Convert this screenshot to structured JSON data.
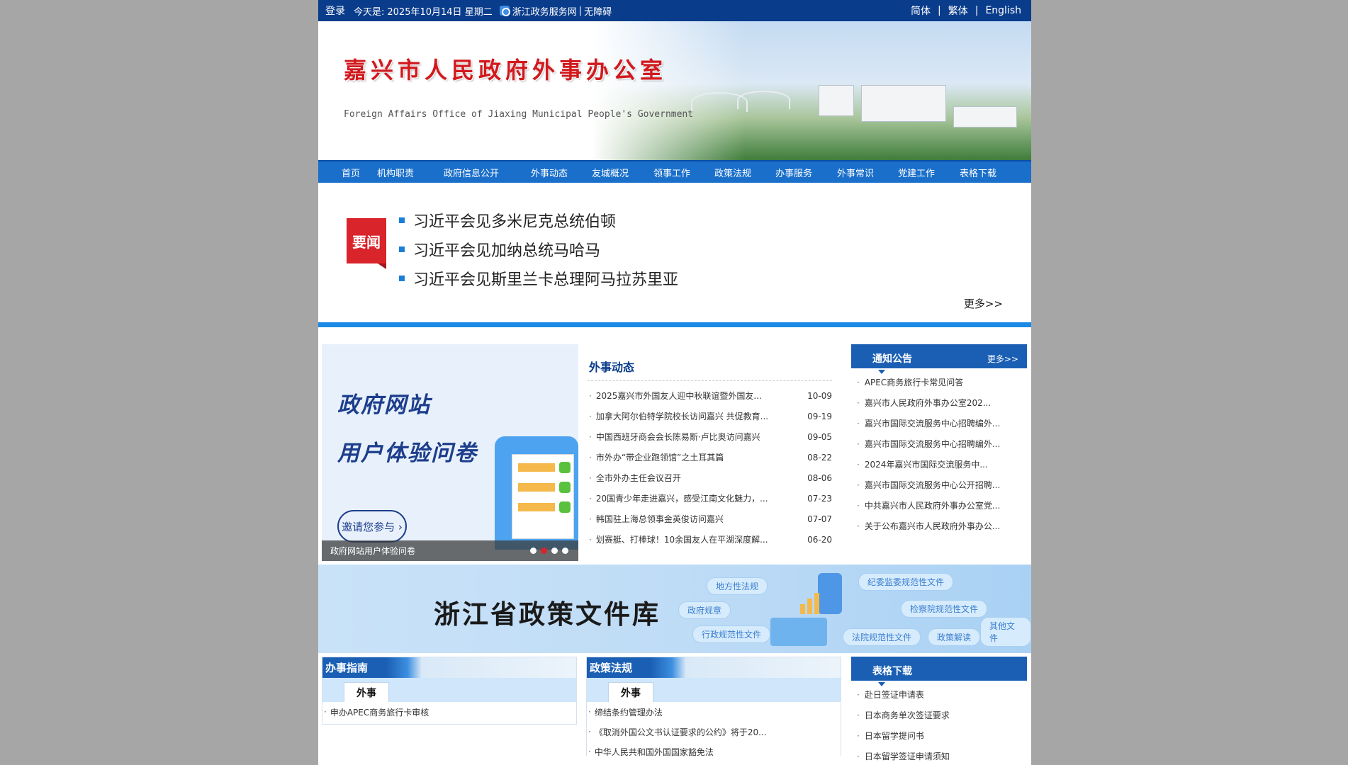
{
  "topbar": {
    "login": "登录",
    "today_label": "今天是:",
    "date": "2025年10月14日 星期二",
    "zw_link": "浙江政务服务网",
    "sep": "|",
    "accessibility": "无障碍",
    "lang_simple": "简体",
    "lang_trad": "繁体",
    "lang_en": "English"
  },
  "banner": {
    "title": "嘉兴市人民政府外事办公室",
    "subtitle": "Foreign Affairs Office of Jiaxing Municipal People's Government"
  },
  "nav": [
    "首页",
    "机构职责",
    "政府信息公开",
    "外事动态",
    "友城概况",
    "领事工作",
    "政策法规",
    "办事服务",
    "外事常识",
    "党建工作",
    "表格下载"
  ],
  "headline": {
    "badge": "要闻",
    "items": [
      "习近平会见多米尼克总统伯顿",
      "习近平会见加纳总统马哈马",
      "习近平会见斯里兰卡总理阿马拉苏里亚"
    ],
    "more": "更多>>"
  },
  "slider": {
    "line1": "政府网站",
    "line2": "用户体验问卷",
    "invite": "邀请您参与 ›",
    "caption": "政府网站用户体验问卷",
    "dots": 4,
    "active_dot": 2
  },
  "news": {
    "title": "外事动态",
    "items": [
      {
        "text": "2025嘉兴市外国友人迎中秋联谊暨外国友...",
        "date": "10-09"
      },
      {
        "text": "加拿大阿尔伯特学院校长访问嘉兴 共促教育...",
        "date": "09-19"
      },
      {
        "text": "中国西班牙商会会长陈易斯·卢比奥访问嘉兴",
        "date": "09-05"
      },
      {
        "text": "市外办“带企业跑领馆”之土耳其篇",
        "date": "08-22"
      },
      {
        "text": "全市外办主任会议召开",
        "date": "08-06"
      },
      {
        "text": "20国青少年走进嘉兴，感受江南文化魅力，...",
        "date": "07-23"
      },
      {
        "text": "韩国驻上海总领事金英俊访问嘉兴",
        "date": "07-07"
      },
      {
        "text": "划赛艇、打棒球！10余国友人在平湖深度解...",
        "date": "06-20"
      }
    ]
  },
  "notice": {
    "title": "通知公告",
    "more": "更多>>",
    "items": [
      "APEC商务旅行卡常见问答",
      "嘉兴市人民政府外事办公室202...",
      "嘉兴市国际交流服务中心招聘编外...",
      "嘉兴市国际交流服务中心招聘编外...",
      "2024年嘉兴市国际交流服务中...",
      "嘉兴市国际交流服务中心公开招聘...",
      "中共嘉兴市人民政府外事办公室党...",
      "关于公布嘉兴市人民政府外事办公..."
    ]
  },
  "policy": {
    "title": "浙江省政策文件库",
    "tags": [
      "地方性法规",
      "纪委监委规范性文件",
      "政府规章",
      "检察院规范性文件",
      "行政规范性文件",
      "法院规范性文件",
      "政策解读",
      "其他文件"
    ]
  },
  "guide": {
    "title": "办事指南",
    "tab": "外事",
    "items": [
      "申办APEC商务旅行卡审核"
    ]
  },
  "laws": {
    "title": "政策法规",
    "tab": "外事",
    "items": [
      "缔结条约管理办法",
      "《取消外国公文书认证要求的公约》将于20...",
      "中华人民共和国外国国家豁免法"
    ]
  },
  "forms": {
    "title": "表格下载",
    "items": [
      "赴日签证申请表",
      "日本商务单次签证要求",
      "日本留学提问书",
      "日本留学签证申请须知"
    ]
  },
  "colors": {
    "topbar": "#0a3c8c",
    "nav": "#1a6fca",
    "accent_red": "#d9242b",
    "accent_blue": "#1a8ae6"
  }
}
